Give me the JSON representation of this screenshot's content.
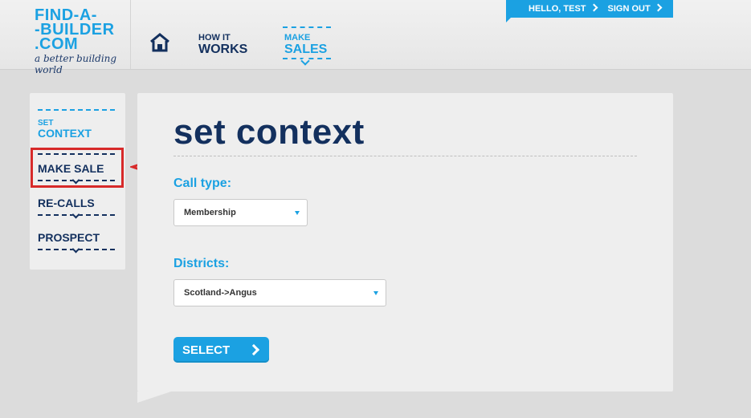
{
  "header": {
    "logo": {
      "line1": "FIND-A-",
      "line2": "-BUILDER",
      "line3": ".COM",
      "tagline": "a better building world"
    },
    "nav": {
      "how": {
        "small": "HOW IT",
        "big": "WORKS"
      },
      "make": {
        "small": "MAKE",
        "big": "SALES"
      }
    },
    "user": {
      "hello": "HELLO, TEST",
      "signout": "SIGN OUT"
    }
  },
  "sidebar": {
    "context": {
      "small": "SET",
      "big": "CONTEXT"
    },
    "items": [
      "MAKE SALE",
      "RE-CALLS",
      "PROSPECT"
    ]
  },
  "main": {
    "title": "set context",
    "call_type": {
      "label": "Call type:",
      "value": "Membership"
    },
    "districts": {
      "label": "Districts:",
      "value": "Scotland->Angus"
    },
    "button": "SELECT"
  },
  "colors": {
    "accent": "#1ba1e2",
    "navy": "#13305e",
    "annotation": "#d72a2a"
  }
}
